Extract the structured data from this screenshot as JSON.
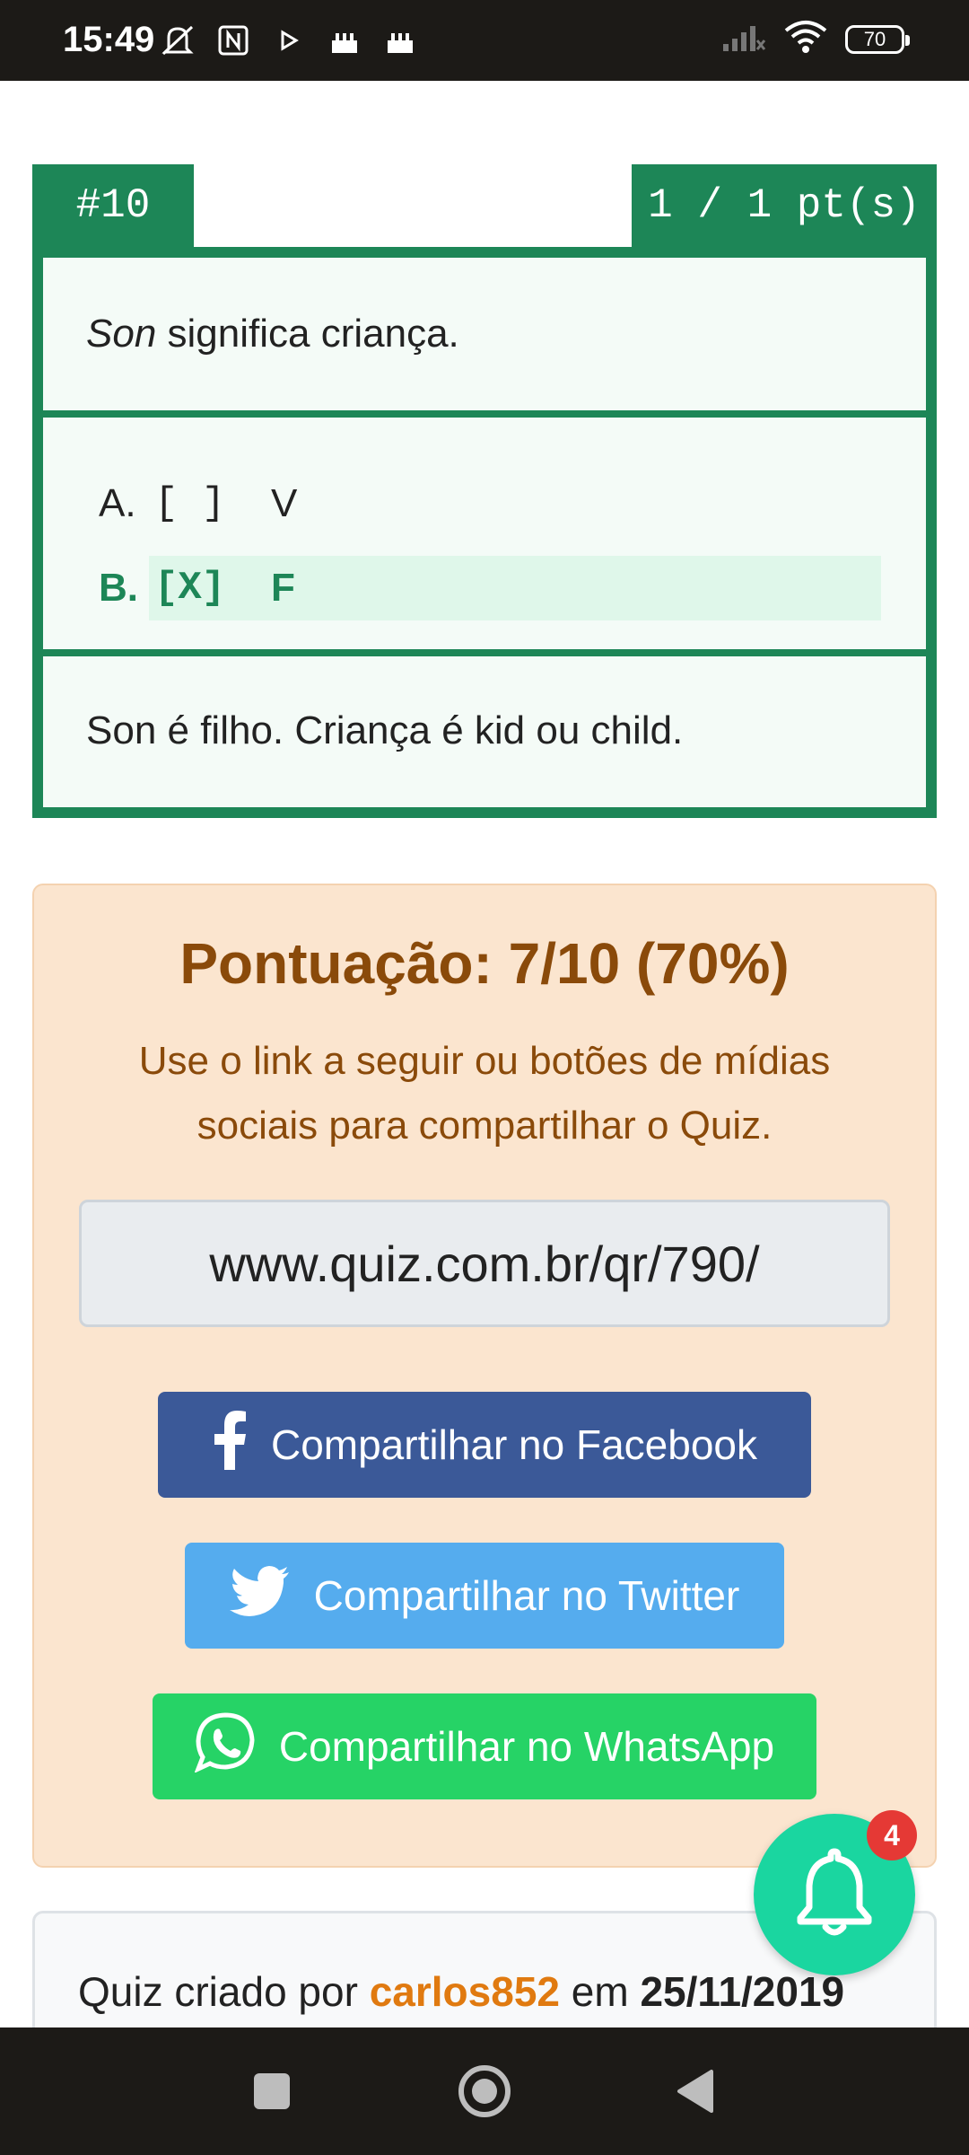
{
  "status_bar": {
    "time": "15:49",
    "battery": "70",
    "icons": [
      "mute-off-icon",
      "nfc-icon",
      "play-icon",
      "cake-icon",
      "cake-icon",
      "signal-icon",
      "wifi-icon",
      "battery-icon"
    ]
  },
  "question": {
    "number": "#10",
    "points": "1 / 1 pt(s)",
    "prompt_emph": "Son",
    "prompt_rest": " significa criança.",
    "options": [
      {
        "label": "A.",
        "box": "[ ]",
        "text": "V"
      },
      {
        "label": "B.",
        "box": "[X]",
        "text": "F"
      }
    ],
    "explanation": "Son é filho. Criança é kid ou child."
  },
  "score": {
    "title": "Pontuação: 7/10 (70%)",
    "subtitle": "Use o link a seguir ou botões de mídias sociais para compartilhar o Quiz.",
    "link": "www.quiz.com.br/qr/790/",
    "share_facebook": "Compartilhar no Facebook",
    "share_twitter": "Compartilhar no Twitter",
    "share_whatsapp": "Compartilhar no WhatsApp"
  },
  "creator": {
    "prefix": "Quiz criado por ",
    "user": "carlos852",
    "middle": " em ",
    "date": "25/11/2019"
  },
  "notifications": {
    "count": "4"
  },
  "colors": {
    "accent_green": "#1d8657",
    "score_bg": "#fbe5cf",
    "score_text": "#8a4a0a",
    "facebook": "#3b5998",
    "twitter": "#55acee",
    "whatsapp": "#26d366",
    "bell": "#1ad6a0",
    "badge": "#e53935",
    "creator_user": "#e07a10"
  }
}
